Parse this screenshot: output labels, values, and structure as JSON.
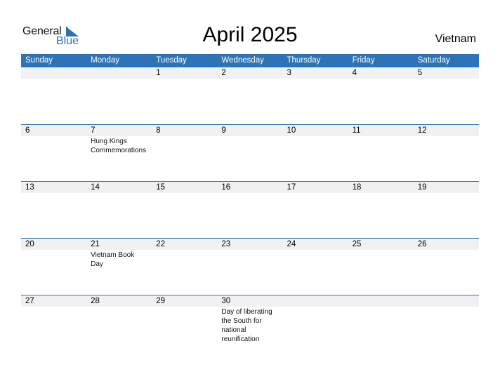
{
  "logo": {
    "general": "General",
    "blue": "Blue"
  },
  "title": "April 2025",
  "country": "Vietnam",
  "colors": {
    "header": "#2e73b5",
    "strip": "#f1f1f1",
    "brand": "#2a70b6"
  },
  "days": [
    "Sunday",
    "Monday",
    "Tuesday",
    "Wednesday",
    "Thursday",
    "Friday",
    "Saturday"
  ],
  "weeks": [
    [
      {
        "n": ""
      },
      {
        "n": ""
      },
      {
        "n": "1"
      },
      {
        "n": "2"
      },
      {
        "n": "3"
      },
      {
        "n": "4"
      },
      {
        "n": "5"
      }
    ],
    [
      {
        "n": "6"
      },
      {
        "n": "7",
        "e": "Hung Kings Commemorations"
      },
      {
        "n": "8"
      },
      {
        "n": "9"
      },
      {
        "n": "10"
      },
      {
        "n": "11"
      },
      {
        "n": "12"
      }
    ],
    [
      {
        "n": "13"
      },
      {
        "n": "14"
      },
      {
        "n": "15"
      },
      {
        "n": "16"
      },
      {
        "n": "17"
      },
      {
        "n": "18"
      },
      {
        "n": "19"
      }
    ],
    [
      {
        "n": "20"
      },
      {
        "n": "21",
        "e": "Vietnam Book Day"
      },
      {
        "n": "22"
      },
      {
        "n": "23"
      },
      {
        "n": "24"
      },
      {
        "n": "25"
      },
      {
        "n": "26"
      }
    ],
    [
      {
        "n": "27"
      },
      {
        "n": "28"
      },
      {
        "n": "29"
      },
      {
        "n": "30",
        "e": "Day of liberating the South for national reunification"
      },
      {
        "n": ""
      },
      {
        "n": ""
      },
      {
        "n": ""
      }
    ]
  ]
}
